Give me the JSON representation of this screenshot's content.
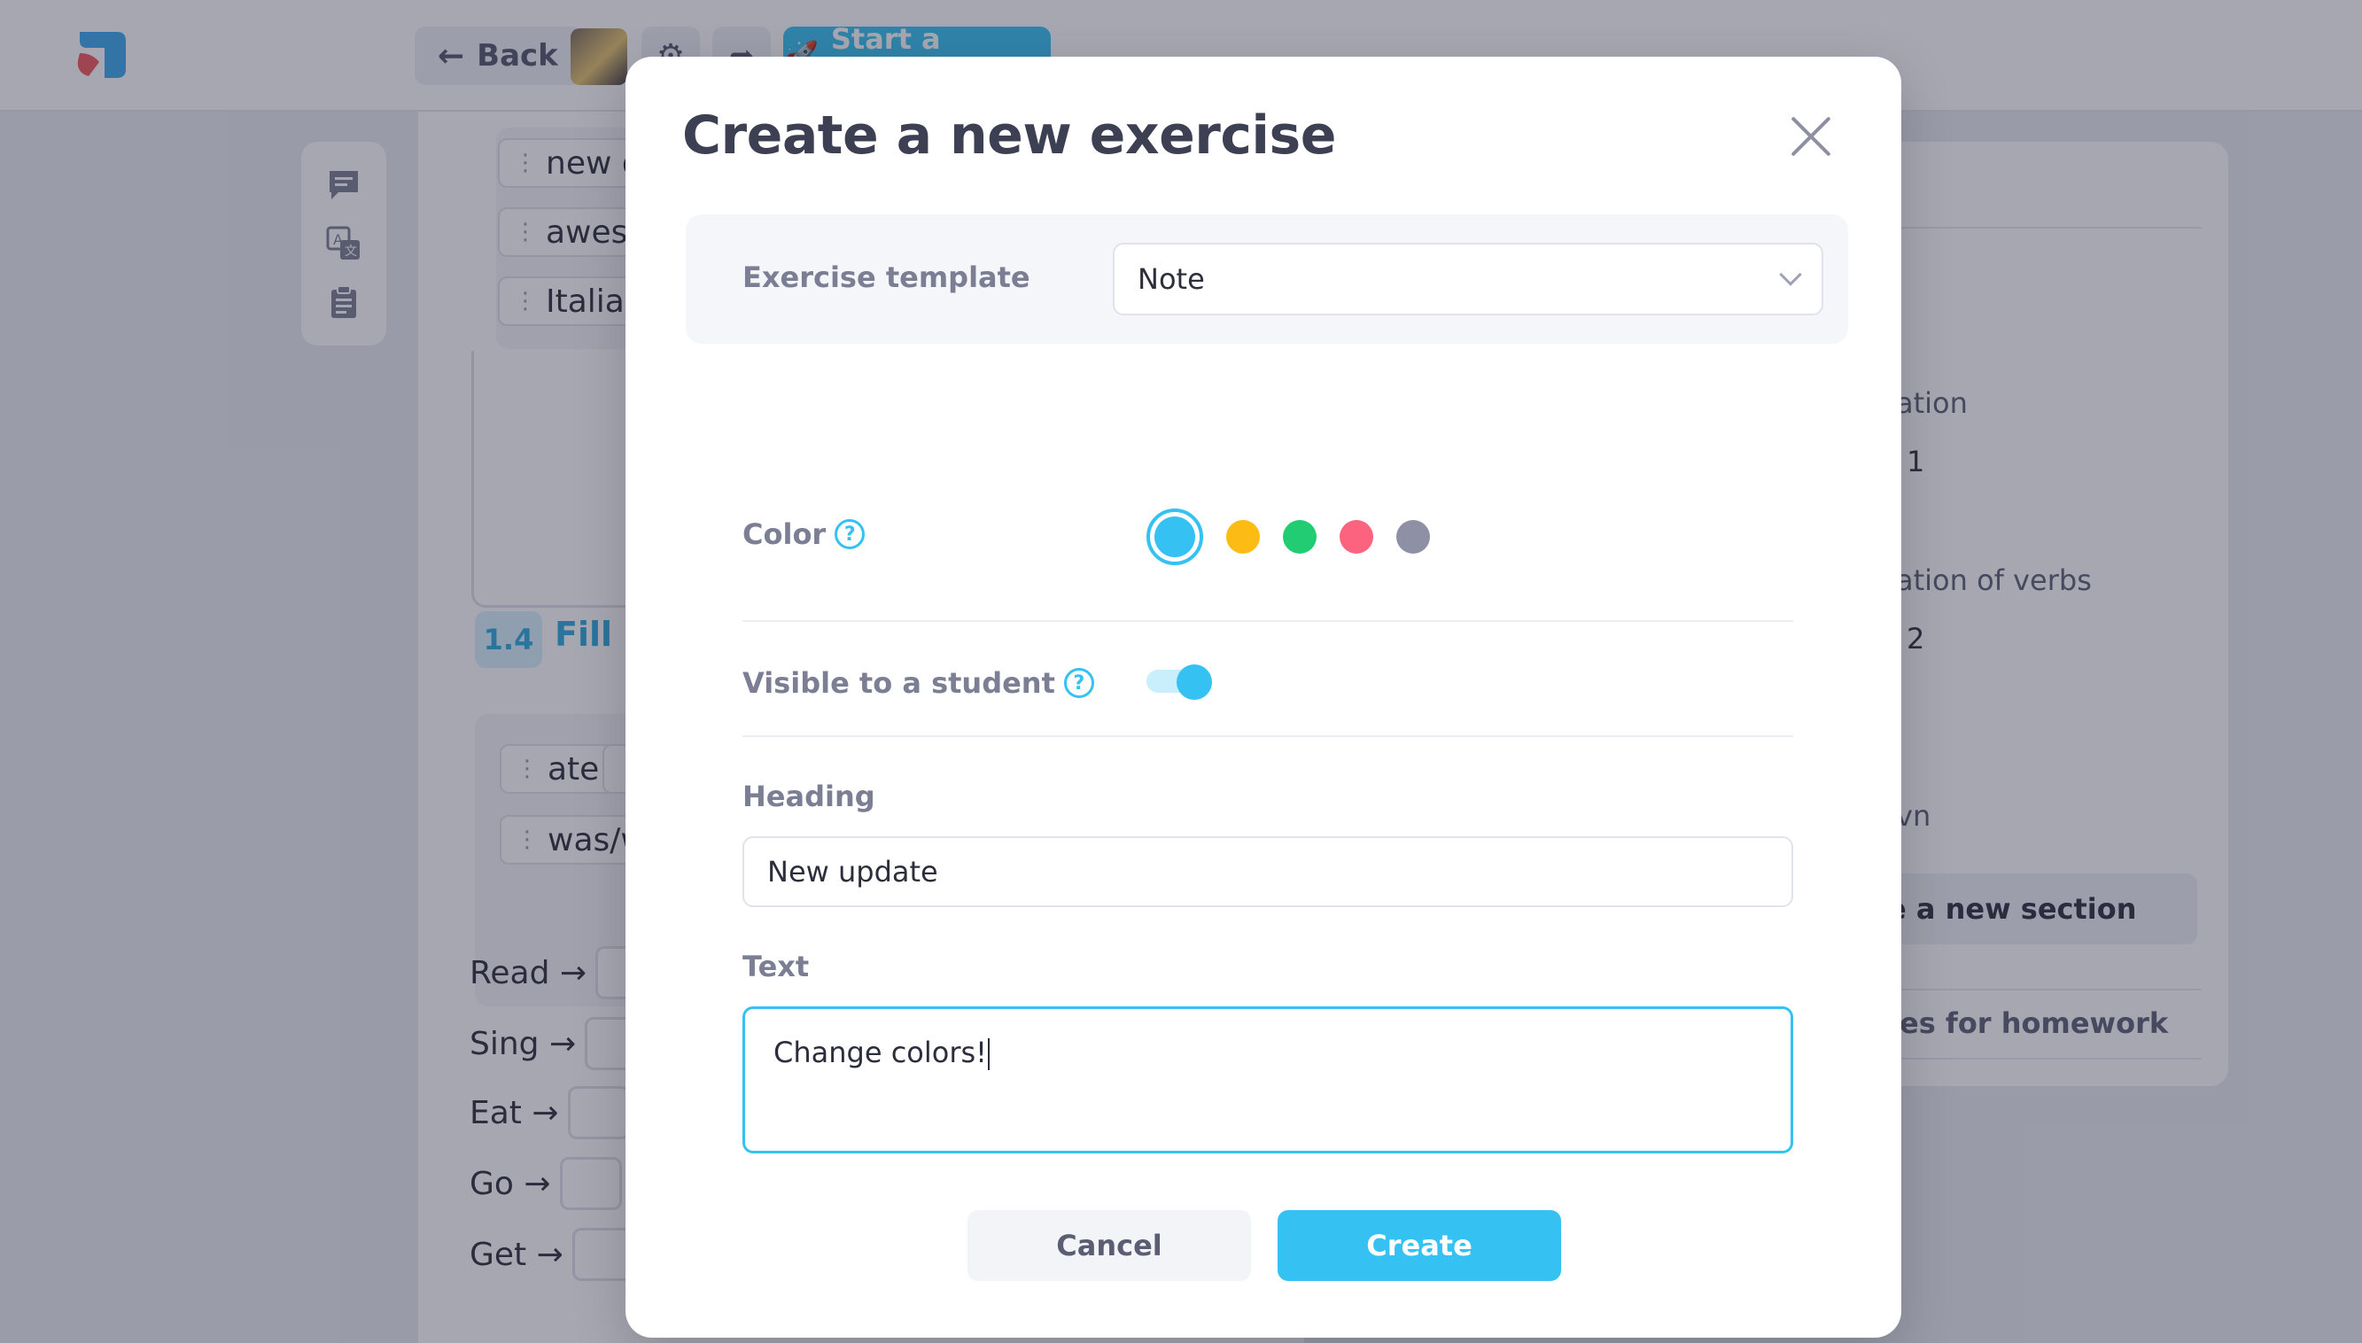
{
  "topbar": {
    "back_label": "Back",
    "start_label": "Start a lesson"
  },
  "background": {
    "chips_top": [
      "new de",
      "awesor",
      "Italian"
    ],
    "section_number": "1.4",
    "section_title": "Fill i",
    "chips_bottom": [
      "ate",
      "",
      "was/we"
    ],
    "verbs": [
      "Read →",
      "Sing →",
      "Eat →",
      "Go →",
      "Get →"
    ],
    "right_panel": {
      "item1": "ation",
      "item1_num": "1",
      "item2": "ation of verbs",
      "item2_num": "2",
      "item3": "vn",
      "new_section_label": "e a new section",
      "homework_label": "es for homework"
    }
  },
  "modal": {
    "title": "Create a new exercise",
    "template_label": "Exercise template",
    "template_value": "Note",
    "color_label": "Color",
    "colors": [
      "#35c2f3",
      "#fdbc14",
      "#22cc72",
      "#fb637e",
      "#8e90a6"
    ],
    "selected_color_index": 0,
    "visible_label": "Visible to a student",
    "visible_on": true,
    "heading_label": "Heading",
    "heading_value": "New update",
    "text_label": "Text",
    "text_value": "Change colors!",
    "cancel_label": "Cancel",
    "create_label": "Create",
    "help_glyph": "?"
  }
}
